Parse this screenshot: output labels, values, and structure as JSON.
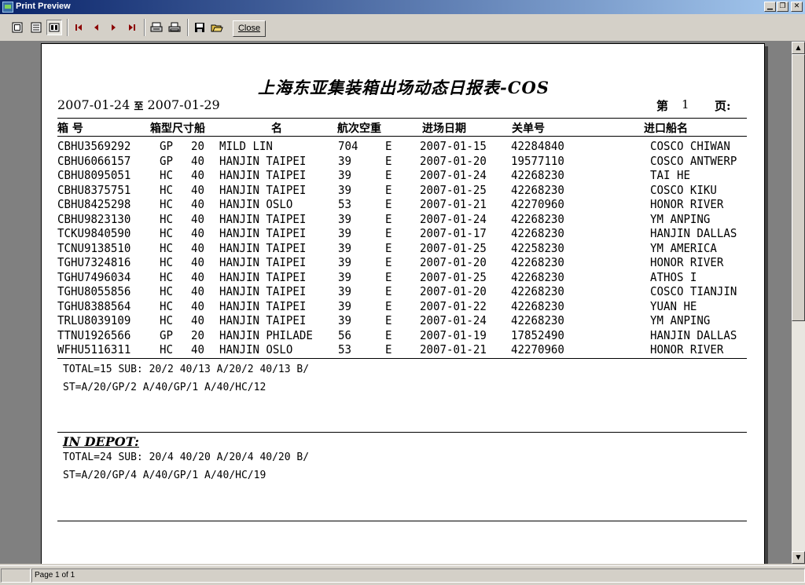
{
  "window": {
    "title": "Print Preview"
  },
  "toolbar": {
    "close_label": "Close",
    "buttons": [
      "one-page-icon",
      "page-width-icon",
      "multi-page-icon",
      "first-page-icon",
      "prev-page-icon",
      "next-page-icon",
      "last-page-icon",
      "print-setup-icon",
      "print-icon",
      "save-icon",
      "open-icon"
    ]
  },
  "report": {
    "title": "上海东亚集装箱出场动态日报表-COS",
    "date_from": "2007-01-24",
    "date_to_sep": "至",
    "date_to": "2007-01-29",
    "page_prefix": "第",
    "page_num": "1",
    "page_suffix": "页:",
    "headers": {
      "container_no": "箱  号",
      "type_size_ship": "箱型尺寸船",
      "name": "名",
      "voyage_le": "航次空重",
      "date": "进场日期",
      "customs_no": "关单号",
      "import_ship": "进口船名"
    },
    "rows": [
      {
        "ctn": "CBHU3569292",
        "type": "GP",
        "size": "20",
        "ship": "MILD LIN",
        "voy": "704",
        "le": "E",
        "date": "2007-01-15",
        "customs": "42284840",
        "import_ship": "COSCO CHIWAN"
      },
      {
        "ctn": "CBHU6066157",
        "type": "GP",
        "size": "40",
        "ship": "HANJIN TAIPEI",
        "voy": "39",
        "le": "E",
        "date": "2007-01-20",
        "customs": "19577110",
        "import_ship": "COSCO ANTWERP"
      },
      {
        "ctn": "CBHU8095051",
        "type": "HC",
        "size": "40",
        "ship": "HANJIN TAIPEI",
        "voy": "39",
        "le": "E",
        "date": "2007-01-24",
        "customs": "42268230",
        "import_ship": "TAI HE"
      },
      {
        "ctn": "CBHU8375751",
        "type": "HC",
        "size": "40",
        "ship": "HANJIN TAIPEI",
        "voy": "39",
        "le": "E",
        "date": "2007-01-25",
        "customs": "42268230",
        "import_ship": "COSCO KIKU"
      },
      {
        "ctn": "CBHU8425298",
        "type": "HC",
        "size": "40",
        "ship": "HANJIN OSLO",
        "voy": "53",
        "le": "E",
        "date": "2007-01-21",
        "customs": "42270960",
        "import_ship": "HONOR RIVER"
      },
      {
        "ctn": "CBHU9823130",
        "type": "HC",
        "size": "40",
        "ship": "HANJIN TAIPEI",
        "voy": "39",
        "le": "E",
        "date": "2007-01-24",
        "customs": "42268230",
        "import_ship": "YM ANPING"
      },
      {
        "ctn": "TCKU9840590",
        "type": "HC",
        "size": "40",
        "ship": "HANJIN TAIPEI",
        "voy": "39",
        "le": "E",
        "date": "2007-01-17",
        "customs": "42268230",
        "import_ship": "HANJIN DALLAS"
      },
      {
        "ctn": "TCNU9138510",
        "type": "HC",
        "size": "40",
        "ship": "HANJIN TAIPEI",
        "voy": "39",
        "le": "E",
        "date": "2007-01-25",
        "customs": "42258230",
        "import_ship": "YM AMERICA"
      },
      {
        "ctn": "TGHU7324816",
        "type": "HC",
        "size": "40",
        "ship": "HANJIN TAIPEI",
        "voy": "39",
        "le": "E",
        "date": "2007-01-20",
        "customs": "42268230",
        "import_ship": "HONOR RIVER"
      },
      {
        "ctn": "TGHU7496034",
        "type": "HC",
        "size": "40",
        "ship": "HANJIN TAIPEI",
        "voy": "39",
        "le": "E",
        "date": "2007-01-25",
        "customs": "42268230",
        "import_ship": "ATHOS I"
      },
      {
        "ctn": "TGHU8055856",
        "type": "HC",
        "size": "40",
        "ship": "HANJIN TAIPEI",
        "voy": "39",
        "le": "E",
        "date": "2007-01-20",
        "customs": "42268230",
        "import_ship": "COSCO TIANJIN"
      },
      {
        "ctn": "TGHU8388564",
        "type": "HC",
        "size": "40",
        "ship": "HANJIN TAIPEI",
        "voy": "39",
        "le": "E",
        "date": "2007-01-22",
        "customs": "42268230",
        "import_ship": "YUAN HE"
      },
      {
        "ctn": "TRLU8039109",
        "type": "HC",
        "size": "40",
        "ship": "HANJIN TAIPEI",
        "voy": "39",
        "le": "E",
        "date": "2007-01-24",
        "customs": "42268230",
        "import_ship": "YM ANPING"
      },
      {
        "ctn": "TTNU1926566",
        "type": "GP",
        "size": "20",
        "ship": "HANJIN PHILADE",
        "voy": "56",
        "le": "E",
        "date": "2007-01-19",
        "customs": "17852490",
        "import_ship": "HANJIN DALLAS"
      },
      {
        "ctn": "WFHU5116311",
        "type": "HC",
        "size": "40",
        "ship": "HANJIN OSLO",
        "voy": "53",
        "le": "E",
        "date": "2007-01-21",
        "customs": "42270960",
        "import_ship": "HONOR RIVER"
      }
    ],
    "summary_total": "TOTAL=15 SUB: 20/2 40/13 A/20/2 40/13 B/",
    "summary_st": "ST=A/20/GP/2 A/40/GP/1 A/40/HC/12",
    "in_depot_label": "IN DEPOT:",
    "depot_total": "TOTAL=24 SUB: 20/4 40/20 A/20/4 40/20 B/",
    "depot_st": "ST=A/20/GP/4 A/40/GP/1 A/40/HC/19"
  },
  "status": {
    "page_info": "Page 1 of 1"
  }
}
